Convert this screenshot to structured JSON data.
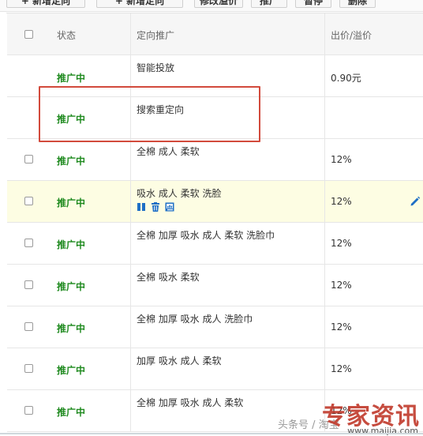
{
  "toolbar": {
    "buttons": [
      {
        "label": "+ 新增定向"
      },
      {
        "label": "+ 新增定向"
      },
      {
        "label": "修改溢价"
      },
      {
        "label": "推广"
      },
      {
        "label": "暂停"
      },
      {
        "label": "删除"
      }
    ]
  },
  "table": {
    "headers": {
      "status": "状态",
      "target": "定向推广",
      "price": "出价/溢价"
    },
    "rows": [
      {
        "status": "推广中",
        "target": "智能投放",
        "price": "0.90元",
        "checkbox": false
      },
      {
        "status": "推广中",
        "target": "搜索重定向",
        "price": "",
        "checkbox": false
      },
      {
        "status": "推广中",
        "target": "全棉 成人 柔软",
        "price": "12%",
        "checkbox": true
      },
      {
        "status": "推广中",
        "target": "吸水 成人 柔软 洗脸",
        "price": "12%",
        "checkbox": true,
        "highlighted": true
      },
      {
        "status": "推广中",
        "target": "全棉 加厚 吸水 成人 柔软 洗脸巾",
        "price": "12%",
        "checkbox": true
      },
      {
        "status": "推广中",
        "target": "全棉 吸水 柔软",
        "price": "12%",
        "checkbox": true
      },
      {
        "status": "推广中",
        "target": "全棉 加厚 吸水 成人 洗脸巾",
        "price": "12%",
        "checkbox": true
      },
      {
        "status": "推广中",
        "target": "加厚 吸水 成人 柔软",
        "price": "12%",
        "checkbox": true
      },
      {
        "status": "推广中",
        "target": "全棉 加厚 吸水 成人 柔软",
        "price": "12%",
        "checkbox": true
      }
    ]
  },
  "row_icons": [
    "pause-icon",
    "trash-icon",
    "report-icon"
  ],
  "watermark": {
    "small": "头条号 / 淘宝",
    "big": "专家资讯",
    "url": "www.maijia.com"
  },
  "colors": {
    "status_green": "#1f8a1f",
    "highlight_row": "#fdfde3",
    "red_box": "#d24a3c",
    "icon_blue": "#1f6fc5"
  }
}
